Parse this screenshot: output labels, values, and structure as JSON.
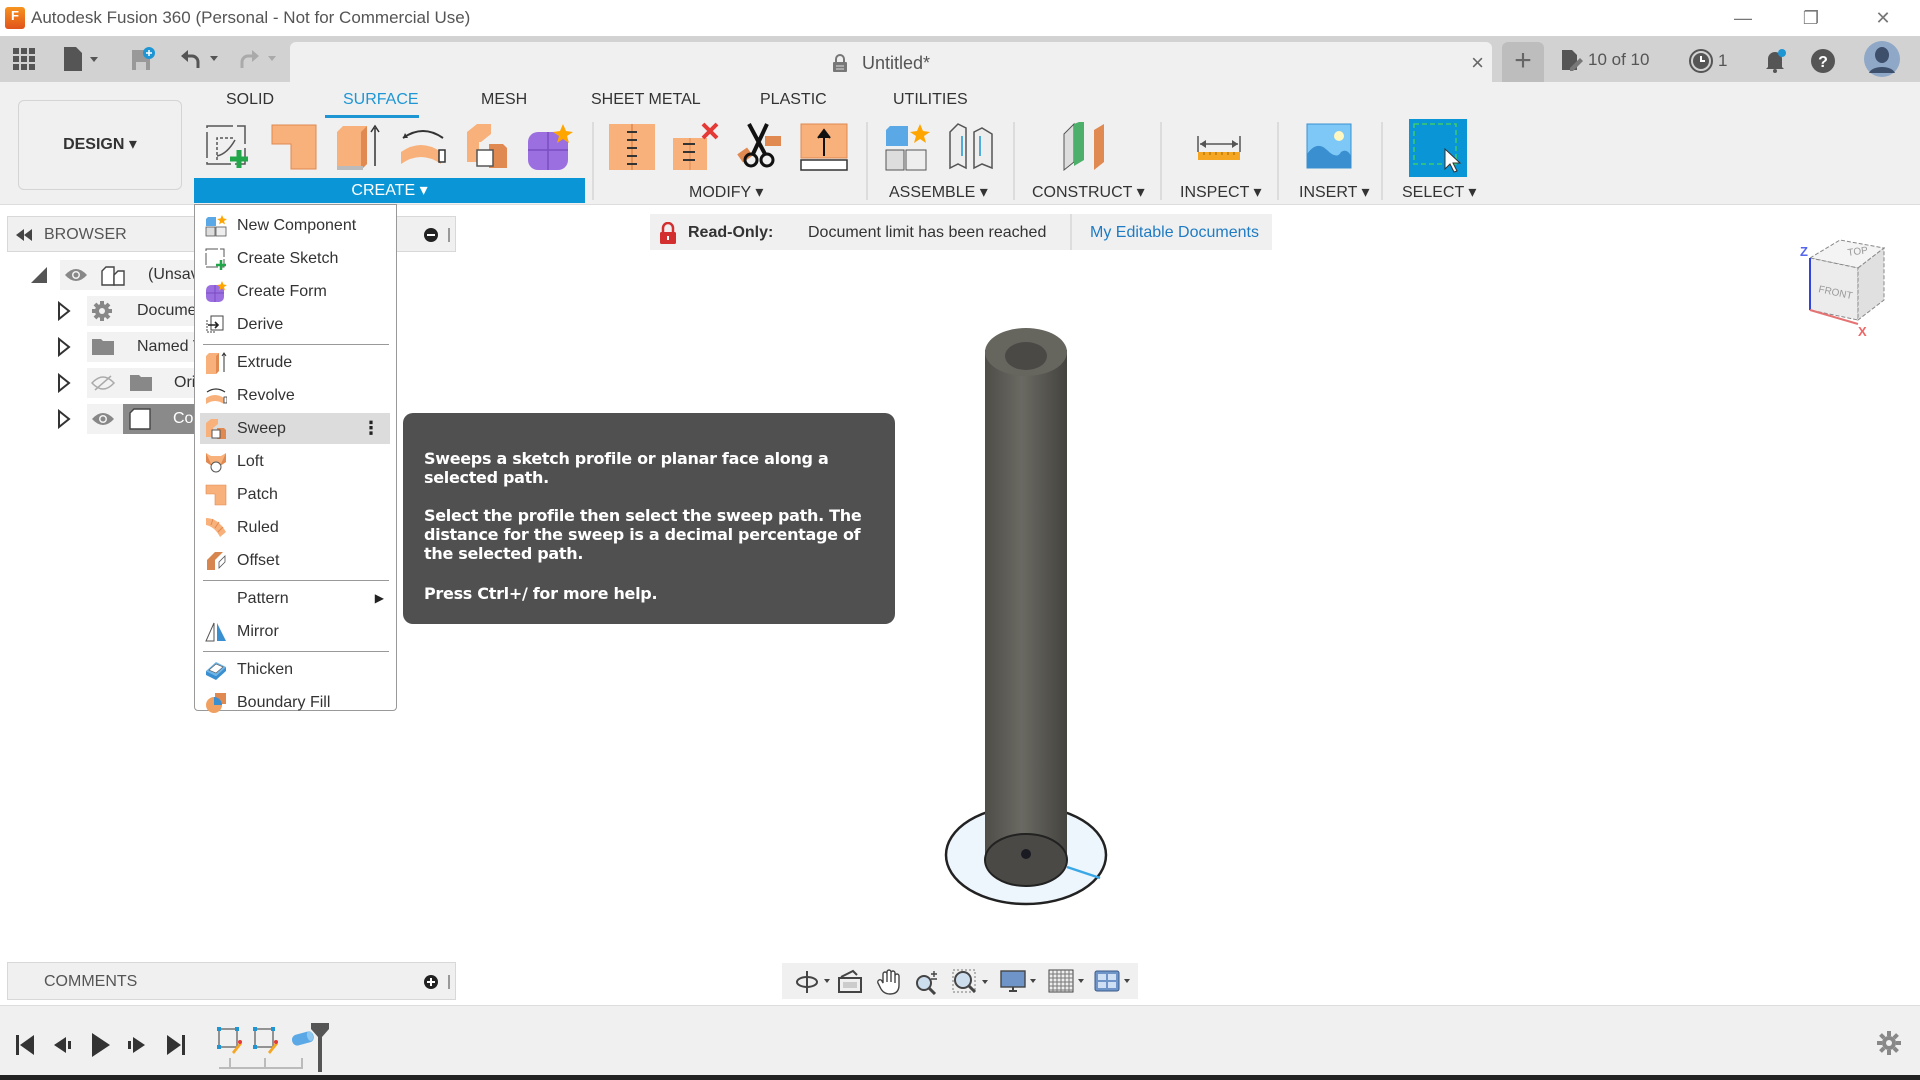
{
  "window": {
    "title": "Autodesk Fusion 360 (Personal - Not for Commercial Use)",
    "app_icon_letter": "F",
    "minimize": "—",
    "restore": "❐",
    "close": "✕"
  },
  "appbar": {
    "document_title": "Untitled*",
    "tab_close": "×",
    "new_tab": "+",
    "doc_count": "10 of 10",
    "jobs_count": "1",
    "colors": {
      "accent": "#1e96d4",
      "notification_dot": "#1e96d4"
    }
  },
  "ribbon": {
    "workspace": "DESIGN ▾",
    "tabs": [
      {
        "label": "SOLID",
        "active": false
      },
      {
        "label": "SURFACE",
        "active": true
      },
      {
        "label": "MESH",
        "active": false
      },
      {
        "label": "SHEET METAL",
        "active": false
      },
      {
        "label": "PLASTIC",
        "active": false
      },
      {
        "label": "UTILITIES",
        "active": false
      }
    ],
    "groups": {
      "create": "CREATE ▾",
      "modify": "MODIFY ▾",
      "assemble": "ASSEMBLE ▾",
      "construct": "CONSTRUCT ▾",
      "inspect": "INSPECT ▾",
      "insert": "INSERT ▾",
      "select": "SELECT ▾"
    }
  },
  "browser": {
    "title": "BROWSER",
    "items": [
      {
        "label": "(Unsav",
        "icon": "component-icon",
        "visible": true
      },
      {
        "label": "Docume",
        "icon": "gear-icon"
      },
      {
        "label": "Named V",
        "icon": "folder-icon"
      },
      {
        "label": "Ori",
        "icon": "folder-icon",
        "visible": false
      },
      {
        "label": "Co",
        "icon": "body-icon",
        "visible": true
      }
    ]
  },
  "banner": {
    "status": "Read-Only:",
    "message": "Document limit has been reached",
    "link": "My Editable Documents"
  },
  "create_menu": {
    "items": [
      {
        "label": "New Component",
        "icon": "new-component-icon"
      },
      {
        "label": "Create Sketch",
        "icon": "create-sketch-icon"
      },
      {
        "label": "Create Form",
        "icon": "create-form-icon"
      },
      {
        "label": "Derive",
        "icon": "derive-icon"
      },
      {
        "label": "Extrude",
        "icon": "extrude-icon"
      },
      {
        "label": "Revolve",
        "icon": "revolve-icon"
      },
      {
        "label": "Sweep",
        "icon": "sweep-icon",
        "hovered": true
      },
      {
        "label": "Loft",
        "icon": "loft-icon"
      },
      {
        "label": "Patch",
        "icon": "patch-icon"
      },
      {
        "label": "Ruled",
        "icon": "ruled-icon"
      },
      {
        "label": "Offset",
        "icon": "offset-icon"
      },
      {
        "label": "Pattern",
        "icon": "",
        "submenu": true
      },
      {
        "label": "Mirror",
        "icon": "mirror-icon"
      },
      {
        "label": "Thicken",
        "icon": "thicken-icon"
      },
      {
        "label": "Boundary Fill",
        "icon": "boundary-fill-icon"
      }
    ],
    "more_glyph": "⋮",
    "submenu_glyph": "▶"
  },
  "tooltip": {
    "line1": "Sweeps a sketch profile or planar face along a selected path.",
    "line2": "Select the profile then select the sweep path. The distance for the sweep is a decimal percentage of the selected path.",
    "line3": "Press Ctrl+/ for more help."
  },
  "viewcube": {
    "top": "TOP",
    "front": "FRONT",
    "axis_z": "Z",
    "axis_x": "X"
  },
  "comments": {
    "title": "COMMENTS"
  }
}
